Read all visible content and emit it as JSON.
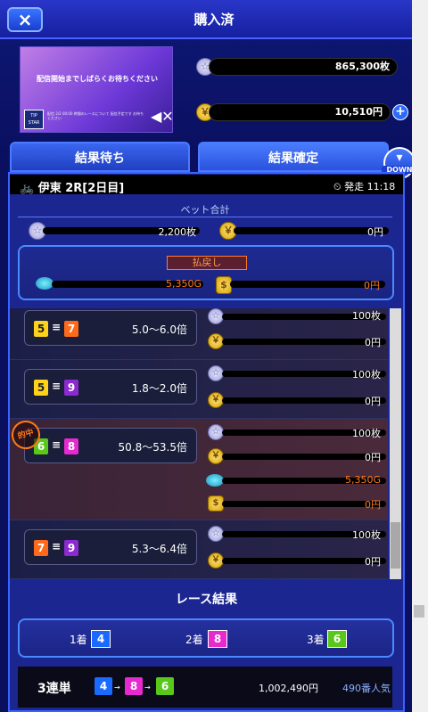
{
  "header": {
    "title": "購入済",
    "close_icon": "×"
  },
  "video": {
    "message": "配信開始までしばらくお待ちください",
    "tip_label": "TIP STAR",
    "mute_icon": "◀✕",
    "small_text": "配信 2/2 00:00 時間のレースについて 配信予定です お待ちください"
  },
  "balances": {
    "points": "865,300枚",
    "cash": "10,510円",
    "plus": "+"
  },
  "tabs": [
    {
      "label": "結果待ち"
    },
    {
      "label": "結果確定"
    }
  ],
  "down_button": {
    "label": "DOWN"
  },
  "race": {
    "name": "伊東 2R[2日目]",
    "start_time": "発走 11:18"
  },
  "bet_summary": {
    "label": "ベット合計",
    "points": "2,200枚",
    "cash": "0円"
  },
  "payout": {
    "label": "払戻し",
    "gems": "5,350G",
    "cash": "0円"
  },
  "tickets": [
    {
      "combo": [
        "5",
        "7"
      ],
      "odds": "5.0～6.0倍",
      "bet": "100枚",
      "cash": "0円"
    },
    {
      "combo": [
        "5",
        "9"
      ],
      "odds": "1.8～2.0倍",
      "bet": "100枚",
      "cash": "0円"
    },
    {
      "combo": [
        "6",
        "8"
      ],
      "odds": "50.8～53.5倍",
      "bet": "100枚",
      "cash": "0円",
      "hit": "的中",
      "gems": "5,350G",
      "payout": "0円"
    },
    {
      "combo": [
        "7",
        "9"
      ],
      "odds": "5.3～6.4倍",
      "bet": "100枚",
      "cash": "0円"
    }
  ],
  "results": {
    "header": "レース結果",
    "places": [
      {
        "label": "1着",
        "num": "4"
      },
      {
        "label": "2着",
        "num": "8"
      },
      {
        "label": "3着",
        "num": "6"
      }
    ],
    "trifecta": {
      "label": "3連単",
      "combo": [
        "4",
        "8",
        "6"
      ],
      "payout": "1,002,490円",
      "popularity": "490番人気"
    }
  },
  "symbols": {
    "equals": "≡",
    "arrow": "→",
    "point_coin": "☆",
    "yen_coin": "￥",
    "gem": "◆",
    "gold_stack": "$"
  },
  "colors": {
    "accent": "#2a52dc",
    "payout": "#ff7a1a"
  }
}
